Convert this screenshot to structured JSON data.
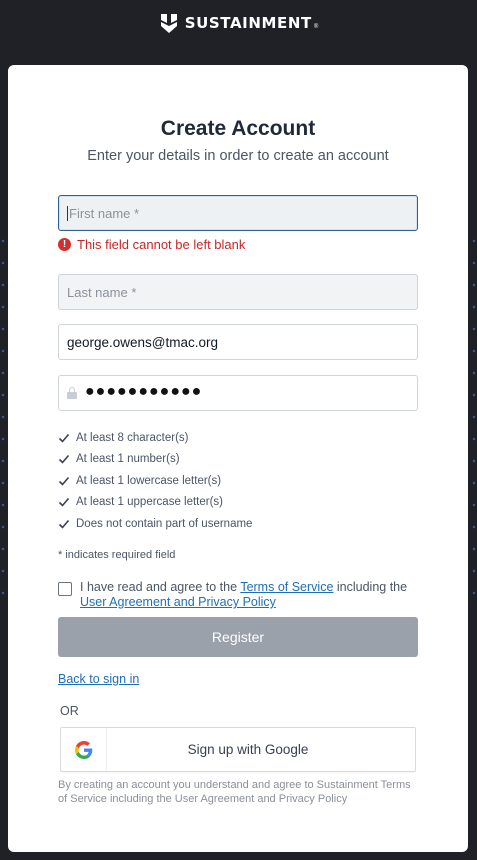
{
  "brand": {
    "name": "SUSTAINMENT",
    "reg": "®"
  },
  "header": {
    "title": "Create Account",
    "subtitle": "Enter your details in order to create an account"
  },
  "form": {
    "first_name": {
      "value": "",
      "placeholder": "First name *"
    },
    "first_name_error": "This field cannot be left blank",
    "last_name": {
      "value": "",
      "placeholder": "Last name *"
    },
    "email": {
      "value": "george.owens@tmac.org"
    },
    "password": {
      "masked": "●●●●●●●●●●●"
    }
  },
  "password_rules": [
    "At least 8 character(s)",
    "At least 1 number(s)",
    "At least 1 lowercase letter(s)",
    "At least 1 uppercase letter(s)",
    "Does not contain part of username"
  ],
  "required_note": "* indicates required field",
  "agreement": {
    "prefix": "I have read and agree to the ",
    "terms_link": "Terms of Service",
    "middle": " including the",
    "policy_link": "User Agreement and Privacy Policy",
    "checked": false
  },
  "buttons": {
    "register": "Register",
    "back_to_sign_in": "Back to sign in",
    "or": "OR",
    "google": "Sign up with Google"
  },
  "footnote": "By creating an account you understand and agree to Sustainment Terms of Service including the User Agreement and Privacy Policy",
  "colors": {
    "background": "#1f2126",
    "error": "#c62828",
    "link": "#1f6fb5",
    "register_disabled": "#9aa1ab"
  }
}
